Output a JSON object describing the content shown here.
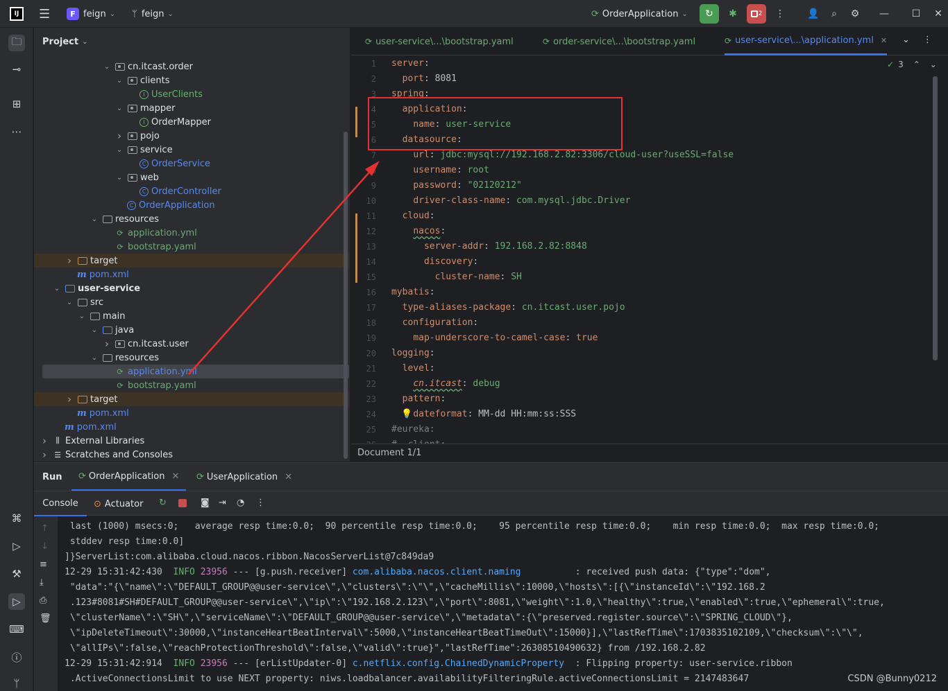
{
  "titlebar": {
    "project_badge": "F",
    "project_name": "feign",
    "branch_name": "feign",
    "run_config": "OrderApplication",
    "run_badge_count": "2"
  },
  "project_panel": {
    "title": "Project",
    "tree": [
      {
        "label": "cn.itcast.order",
        "kind": "package",
        "depth": 5,
        "arrow": "down"
      },
      {
        "label": "clients",
        "kind": "package",
        "depth": 6,
        "arrow": "down"
      },
      {
        "label": "UserClients",
        "kind": "interface",
        "depth": 7,
        "arrow": ""
      },
      {
        "label": "mapper",
        "kind": "package",
        "depth": 6,
        "arrow": "down"
      },
      {
        "label": "OrderMapper",
        "kind": "interface-text",
        "depth": 7,
        "arrow": ""
      },
      {
        "label": "pojo",
        "kind": "package",
        "depth": 6,
        "arrow": "right"
      },
      {
        "label": "service",
        "kind": "package",
        "depth": 6,
        "arrow": "down"
      },
      {
        "label": "OrderService",
        "kind": "class",
        "depth": 7,
        "arrow": ""
      },
      {
        "label": "web",
        "kind": "package",
        "depth": 6,
        "arrow": "down"
      },
      {
        "label": "OrderController",
        "kind": "class",
        "depth": 7,
        "arrow": ""
      },
      {
        "label": "OrderApplication",
        "kind": "app",
        "depth": 6,
        "arrow": ""
      },
      {
        "label": "resources",
        "kind": "resfolder",
        "depth": 4,
        "arrow": "down"
      },
      {
        "label": "application.yml",
        "kind": "yml",
        "depth": 5,
        "arrow": ""
      },
      {
        "label": "bootstrap.yaml",
        "kind": "yml",
        "depth": 5,
        "arrow": ""
      },
      {
        "label": "target",
        "kind": "excluded",
        "depth": 2,
        "arrow": "right"
      },
      {
        "label": "pom.xml",
        "kind": "maven",
        "depth": 2,
        "arrow": ""
      },
      {
        "label": "user-service",
        "kind": "module",
        "depth": 1,
        "arrow": "down"
      },
      {
        "label": "src",
        "kind": "folder",
        "depth": 2,
        "arrow": "down"
      },
      {
        "label": "main",
        "kind": "folder",
        "depth": 3,
        "arrow": "down"
      },
      {
        "label": "java",
        "kind": "srcfolder",
        "depth": 4,
        "arrow": "down"
      },
      {
        "label": "cn.itcast.user",
        "kind": "package",
        "depth": 5,
        "arrow": "right"
      },
      {
        "label": "resources",
        "kind": "resfolder",
        "depth": 4,
        "arrow": "down"
      },
      {
        "label": "application.yml",
        "kind": "yml-selected",
        "depth": 5,
        "arrow": ""
      },
      {
        "label": "bootstrap.yaml",
        "kind": "yml",
        "depth": 5,
        "arrow": ""
      },
      {
        "label": "target",
        "kind": "excluded",
        "depth": 2,
        "arrow": "right"
      },
      {
        "label": "pom.xml",
        "kind": "maven",
        "depth": 2,
        "arrow": ""
      },
      {
        "label": "pom.xml",
        "kind": "maven",
        "depth": 1,
        "arrow": ""
      },
      {
        "label": "External Libraries",
        "kind": "libs",
        "depth": 0,
        "arrow": "right"
      },
      {
        "label": "Scratches and Consoles",
        "kind": "scratch",
        "depth": 0,
        "arrow": "right"
      }
    ]
  },
  "editor": {
    "tabs": [
      {
        "label": "user-service\\...\\bootstrap.yaml",
        "active": false
      },
      {
        "label": "order-service\\...\\bootstrap.yaml",
        "active": false
      },
      {
        "label": "user-service\\...\\application.yml",
        "active": true
      }
    ],
    "inspection_count": "3",
    "status": "Document 1/1",
    "lines": [
      [
        [
          "k",
          "server"
        ],
        [
          "p",
          ":"
        ]
      ],
      [
        [
          "p",
          "  "
        ],
        [
          "k",
          "port"
        ],
        [
          "p",
          ": "
        ],
        [
          "p",
          "8081"
        ]
      ],
      [
        [
          "k",
          "spring"
        ],
        [
          "p",
          ":"
        ]
      ],
      [
        [
          "p",
          "  "
        ],
        [
          "k",
          "application"
        ],
        [
          "p",
          ":"
        ]
      ],
      [
        [
          "p",
          "    "
        ],
        [
          "k",
          "name"
        ],
        [
          "p",
          ": "
        ],
        [
          "v",
          "user-service"
        ]
      ],
      [
        [
          "p",
          "  "
        ],
        [
          "k",
          "datasource"
        ],
        [
          "p",
          ":"
        ]
      ],
      [
        [
          "p",
          "    "
        ],
        [
          "k",
          "url"
        ],
        [
          "p",
          ": "
        ],
        [
          "v",
          "jdbc:mysql://192.168.2.82:3306/cloud-user?useSSL=false"
        ]
      ],
      [
        [
          "p",
          "    "
        ],
        [
          "k",
          "username"
        ],
        [
          "p",
          ": "
        ],
        [
          "v",
          "root"
        ]
      ],
      [
        [
          "p",
          "    "
        ],
        [
          "k",
          "password"
        ],
        [
          "p",
          ": "
        ],
        [
          "v",
          "\"02120212\""
        ]
      ],
      [
        [
          "p",
          "    "
        ],
        [
          "k",
          "driver-class-name"
        ],
        [
          "p",
          ": "
        ],
        [
          "v",
          "com.mysql.jdbc.Driver"
        ]
      ],
      [
        [
          "p",
          "  "
        ],
        [
          "k",
          "cloud"
        ],
        [
          "p",
          ":"
        ]
      ],
      [
        [
          "p",
          "    "
        ],
        [
          "k",
          "nacos"
        ],
        [
          "p",
          ":"
        ]
      ],
      [
        [
          "p",
          "      "
        ],
        [
          "k",
          "server-addr"
        ],
        [
          "p",
          ": "
        ],
        [
          "v",
          "192.168.2.82:8848"
        ]
      ],
      [
        [
          "p",
          "      "
        ],
        [
          "k",
          "discovery"
        ],
        [
          "p",
          ":"
        ]
      ],
      [
        [
          "p",
          "        "
        ],
        [
          "k",
          "cluster-name"
        ],
        [
          "p",
          ": "
        ],
        [
          "v",
          "SH"
        ]
      ],
      [
        [
          "k",
          "mybatis"
        ],
        [
          "p",
          ":"
        ]
      ],
      [
        [
          "p",
          "  "
        ],
        [
          "k",
          "type-aliases-package"
        ],
        [
          "p",
          ": "
        ],
        [
          "v",
          "cn.itcast.user.pojo"
        ]
      ],
      [
        [
          "p",
          "  "
        ],
        [
          "k",
          "configuration"
        ],
        [
          "p",
          ":"
        ]
      ],
      [
        [
          "p",
          "    "
        ],
        [
          "k",
          "map-underscore-to-camel-case"
        ],
        [
          "p",
          ": "
        ],
        [
          "b",
          "true"
        ]
      ],
      [
        [
          "k",
          "logging"
        ],
        [
          "p",
          ":"
        ]
      ],
      [
        [
          "p",
          "  "
        ],
        [
          "k",
          "level"
        ],
        [
          "p",
          ":"
        ]
      ],
      [
        [
          "p",
          "    "
        ],
        [
          "k",
          "cn.itcast"
        ],
        [
          "p",
          ": "
        ],
        [
          "v",
          "debug"
        ]
      ],
      [
        [
          "p",
          "  "
        ],
        [
          "k",
          "pattern"
        ],
        [
          "p",
          ":"
        ]
      ],
      [
        [
          "p",
          "    "
        ],
        [
          "k",
          "dateformat"
        ],
        [
          "p",
          ": "
        ],
        [
          "p",
          "MM-dd HH:mm:ss:SSS"
        ]
      ],
      [
        [
          "cm",
          "#eureka:"
        ]
      ],
      [
        [
          "cm",
          "#  client:"
        ]
      ]
    ]
  },
  "run_panel": {
    "label": "Run",
    "tabs": [
      "OrderApplication",
      "UserApplication"
    ],
    "console_tab": "Console",
    "actuator_tab": "Actuator",
    "console_lines": [
      [
        [
          "t",
          " last (1000) msecs:0;   average resp time:0.0;  90 percentile resp time:0.0;    95 percentile resp time:0.0;    min resp time:0.0;  max resp time:0.0;"
        ]
      ],
      [
        [
          "t",
          " stddev resp time:0.0]"
        ]
      ],
      [
        [
          "t",
          "]}ServerList:com.alibaba.cloud.nacos.ribbon.NacosServerList@7c849da9"
        ]
      ],
      [
        [
          "t",
          "12-29 15:31:42:430  "
        ],
        [
          "info",
          "INFO"
        ],
        [
          "t",
          " "
        ],
        [
          "pid",
          "23956"
        ],
        [
          "t",
          " --- [g.push.receiver] "
        ],
        [
          "logger",
          "com.alibaba.nacos.client.naming"
        ],
        [
          "t",
          "          : received push data: {\"type\":\"dom\","
        ]
      ],
      [
        [
          "t",
          " \"data\":\"{\\\"name\\\":\\\"DEFAULT_GROUP@@user-service\\\",\\\"clusters\\\":\\\"\\\",\\\"cacheMillis\\\":10000,\\\"hosts\\\":[{\\\"instanceId\\\":\\\"192.168.2"
        ]
      ],
      [
        [
          "t",
          " .123#8081#SH#DEFAULT_GROUP@@user-service\\\",\\\"ip\\\":\\\"192.168.2.123\\\",\\\"port\\\":8081,\\\"weight\\\":1.0,\\\"healthy\\\":true,\\\"enabled\\\":true,\\\"ephemeral\\\":true,"
        ]
      ],
      [
        [
          "t",
          " \\\"clusterName\\\":\\\"SH\\\",\\\"serviceName\\\":\\\"DEFAULT_GROUP@@user-service\\\",\\\"metadata\\\":{\\\"preserved.register.source\\\":\\\"SPRING_CLOUD\\\"},"
        ]
      ],
      [
        [
          "t",
          " \\\"ipDeleteTimeout\\\":30000,\\\"instanceHeartBeatInterval\\\":5000,\\\"instanceHeartBeatTimeOut\\\":15000}],\\\"lastRefTime\\\":1703835102109,\\\"checksum\\\":\\\"\\\","
        ]
      ],
      [
        [
          "t",
          " \\\"allIPs\\\":false,\\\"reachProtectionThreshold\\\":false,\\\"valid\\\":true}\",\"lastRefTime\":26308510490632} from /192.168.2.82"
        ]
      ],
      [
        [
          "t",
          "12-29 15:31:42:914  "
        ],
        [
          "info",
          "INFO"
        ],
        [
          "t",
          " "
        ],
        [
          "pid",
          "23956"
        ],
        [
          "t",
          " --- [erListUpdater-0] "
        ],
        [
          "logger",
          "c.netflix.config.ChainedDynamicProperty"
        ],
        [
          "t",
          "  : Flipping property: user-service.ribbon"
        ]
      ],
      [
        [
          "t",
          " .ActiveConnectionsLimit to use NEXT property: niws.loadbalancer.availabilityFilteringRule.activeConnectionsLimit = 2147483647"
        ]
      ]
    ]
  },
  "watermark": "CSDN @Bunny0212",
  "colors": {
    "accent": "#3574f0",
    "annotation_red": "#e5312f",
    "run_green": "#499c54",
    "stop_red": "#c94f4f"
  }
}
